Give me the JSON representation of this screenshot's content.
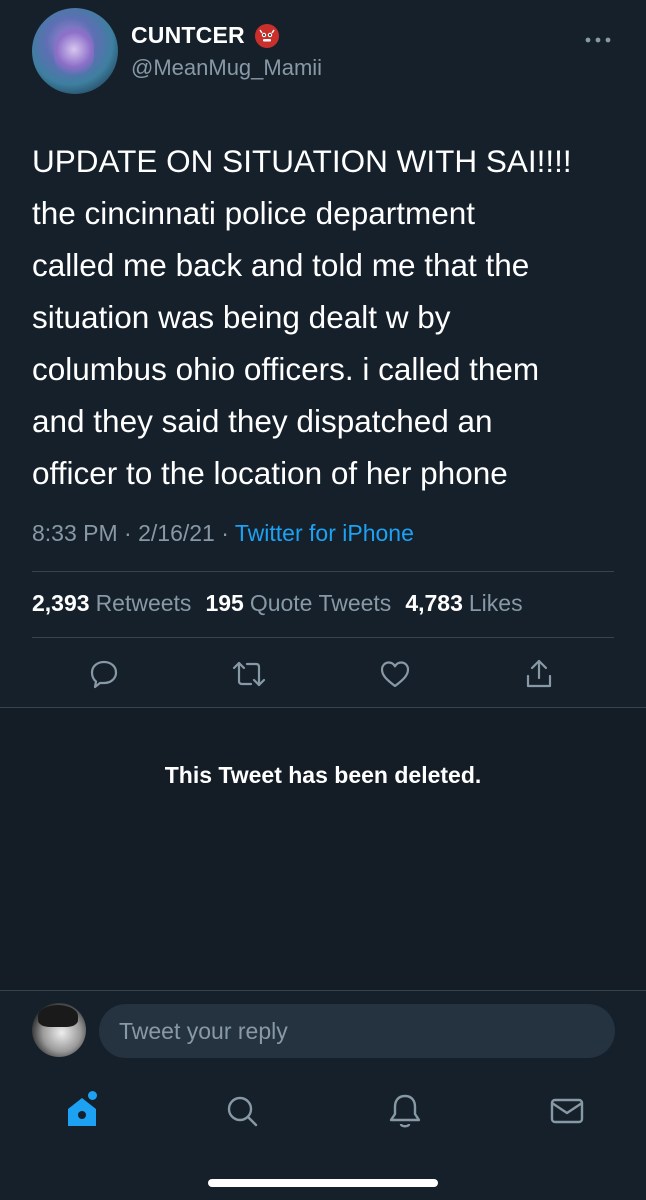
{
  "tweet": {
    "display_name": "CUNTCER",
    "display_name_emoji": "👹",
    "handle": "@MeanMug_Mamii",
    "more_icon": "more-horizontal-icon",
    "body": "UPDATE ON SITUATION WITH SAI!!!!\nthe cincinnati police department\ncalled me back and told me that the\nsituation was being dealt w by\ncolumbus ohio officers. i called them\nand they said they dispatched an\nofficer to the location of her phone",
    "time": "8:33 PM",
    "date": "2/16/21",
    "separator": "·",
    "source": "Twitter for iPhone",
    "stats": {
      "retweets_count": "2,393",
      "retweets_label": "Retweets",
      "quotes_count": "195",
      "quotes_label": "Quote Tweets",
      "likes_count": "4,783",
      "likes_label": "Likes"
    },
    "actions": [
      "reply-icon",
      "retweet-icon",
      "like-icon",
      "share-icon"
    ]
  },
  "deleted_notice": "This Tweet has been deleted.",
  "reply": {
    "placeholder": "Tweet your reply"
  },
  "tabs": [
    "home-icon",
    "search-icon",
    "notifications-icon",
    "messages-icon"
  ],
  "colors": {
    "background": "#15202b",
    "accent": "#1da1f2",
    "secondary_text": "#8899a6",
    "divider": "#38444d"
  }
}
